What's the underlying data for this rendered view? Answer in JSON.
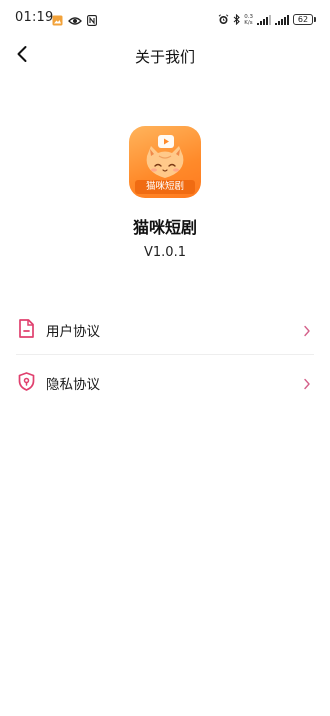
{
  "status_bar": {
    "time": "01:19",
    "net_speed_top": "0.3",
    "net_speed_bottom": "K/s",
    "battery": "62"
  },
  "nav": {
    "title": "关于我们",
    "back_icon": "chevron-left-icon"
  },
  "app": {
    "icon_label": "猫咪短剧",
    "name": "猫咪短剧",
    "version": "V1.0.1"
  },
  "menu": {
    "items": [
      {
        "label": "用户协议",
        "icon": "document-icon"
      },
      {
        "label": "隐私协议",
        "icon": "shield-icon"
      }
    ]
  },
  "colors": {
    "accent": "#e0406e",
    "chevron": "#d4608a",
    "brand_orange": "#ff8a2a"
  }
}
